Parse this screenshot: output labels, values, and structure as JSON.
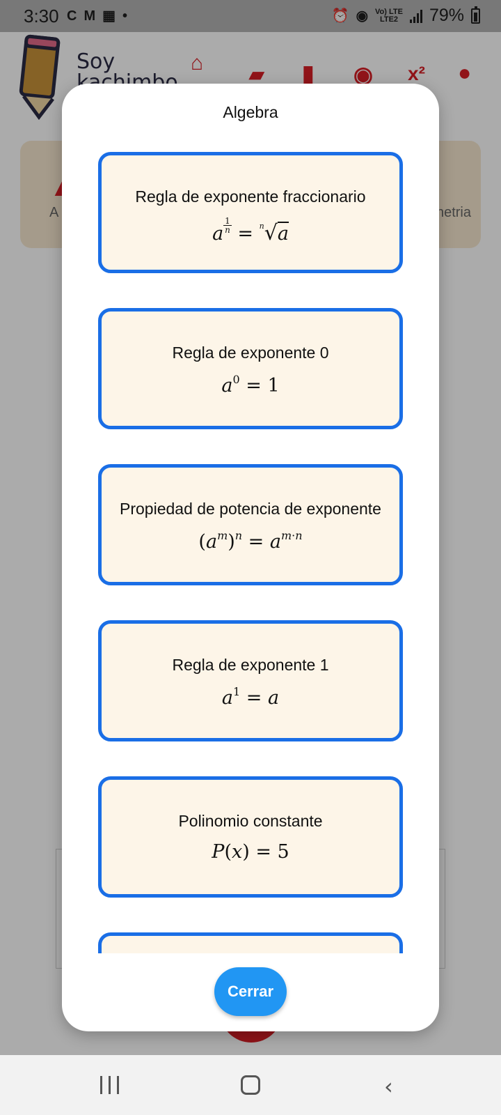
{
  "status_bar": {
    "time": "3:30",
    "network_line1": "Vo) LTE",
    "network_line2": "LTE2",
    "battery": "79%"
  },
  "app": {
    "logo_text": "Soy kachimbo",
    "category_left_label": "A",
    "category_right_label": "netria"
  },
  "modal": {
    "title": "Algebra",
    "cards": [
      {
        "title": "Regla de exponente fraccionario"
      },
      {
        "title": "Regla de exponente 0"
      },
      {
        "title": "Propiedad de potencia de exponente"
      },
      {
        "title": "Regla de exponente 1"
      },
      {
        "title": "Polinomio constante"
      }
    ],
    "close_label": "Cerrar"
  },
  "colors": {
    "card_border": "#1a6ee6",
    "card_background": "#fdf5e8",
    "close_button": "#2196f3",
    "brand_red": "#d81f26"
  }
}
